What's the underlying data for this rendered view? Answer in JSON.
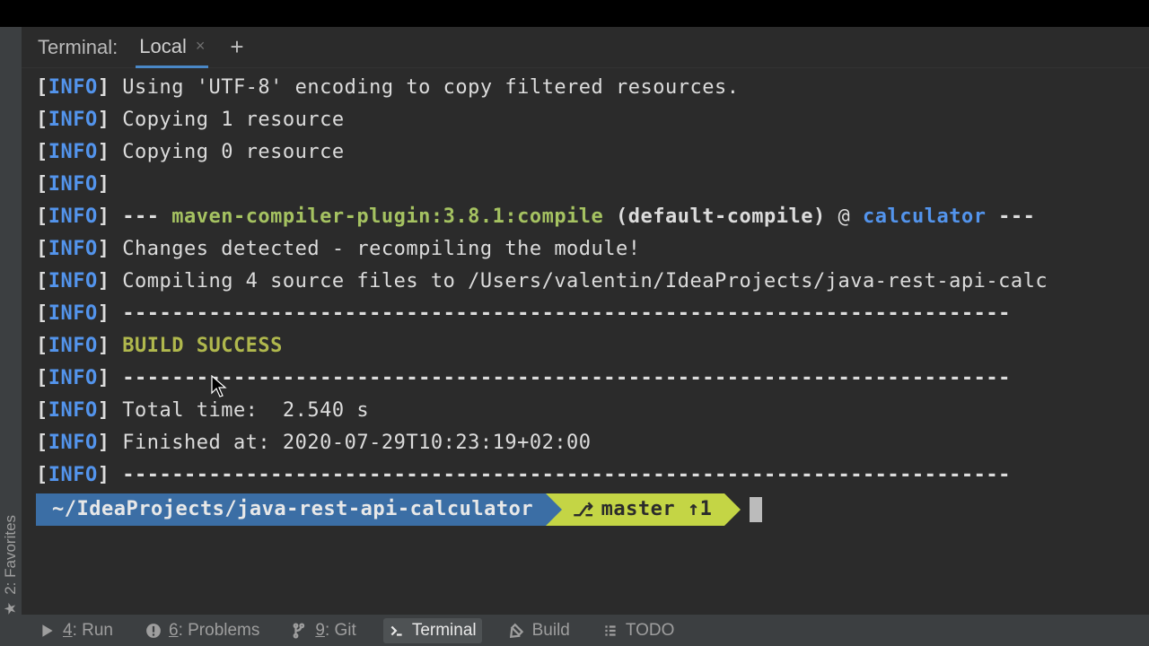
{
  "header": {
    "title": "Terminal:",
    "tab": "Local",
    "close_glyph": "×",
    "plus_glyph": "+"
  },
  "lines": [
    {
      "tag": "INFO",
      "parts": [
        {
          "cls": "c-white",
          "t": "Using 'UTF-8' encoding to copy filtered resources."
        }
      ]
    },
    {
      "tag": "INFO",
      "parts": [
        {
          "cls": "c-white",
          "t": "Copying 1 resource"
        }
      ]
    },
    {
      "tag": "INFO",
      "parts": [
        {
          "cls": "c-white",
          "t": "Copying 0 resource"
        }
      ]
    },
    {
      "tag": "INFO",
      "parts": []
    },
    {
      "tag": "INFO",
      "parts": [
        {
          "cls": "c-bold c-white",
          "t": "--- "
        },
        {
          "cls": "c-green",
          "t": "maven-compiler-plugin:3.8.1:compile"
        },
        {
          "cls": "c-bold c-white",
          "t": " (default-compile)"
        },
        {
          "cls": "c-white",
          "t": " @ "
        },
        {
          "cls": "c-blue",
          "t": "calculator"
        },
        {
          "cls": "c-bold c-white",
          "t": " ---"
        }
      ]
    },
    {
      "tag": "INFO",
      "parts": [
        {
          "cls": "c-white",
          "t": "Changes detected - recompiling the module!"
        }
      ]
    },
    {
      "tag": "INFO",
      "parts": [
        {
          "cls": "c-white",
          "t": "Compiling 4 source files to /Users/valentin/IdeaProjects/java-rest-api-calc"
        }
      ]
    },
    {
      "tag": "INFO",
      "parts": [
        {
          "cls": "c-bold c-white",
          "t": "------------------------------------------------------------------------"
        }
      ]
    },
    {
      "tag": "INFO",
      "parts": [
        {
          "cls": "c-olive",
          "t": "BUILD SUCCESS"
        }
      ]
    },
    {
      "tag": "INFO",
      "parts": [
        {
          "cls": "c-bold c-white",
          "t": "------------------------------------------------------------------------"
        }
      ]
    },
    {
      "tag": "INFO",
      "parts": [
        {
          "cls": "c-white",
          "t": "Total time:  2.540 s"
        }
      ]
    },
    {
      "tag": "INFO",
      "parts": [
        {
          "cls": "c-white",
          "t": "Finished at: 2020-07-29T10:23:19+02:00"
        }
      ]
    },
    {
      "tag": "INFO",
      "parts": [
        {
          "cls": "c-bold c-white",
          "t": "------------------------------------------------------------------------"
        }
      ]
    }
  ],
  "prompt": {
    "path": "~/IdeaProjects/java-rest-api-calculator",
    "branch": "master ↑1"
  },
  "toolwindows": {
    "run": {
      "key": "4",
      "label": ": Run"
    },
    "problems": {
      "key": "6",
      "label": ": Problems"
    },
    "git": {
      "key": "9",
      "label": ": Git"
    },
    "terminal": {
      "label": "Terminal"
    },
    "build": {
      "label": "Build"
    },
    "todo": {
      "label": "TODO"
    }
  },
  "sidebar": {
    "favorites": "2: Favorites"
  },
  "icons": {
    "star": "★"
  }
}
